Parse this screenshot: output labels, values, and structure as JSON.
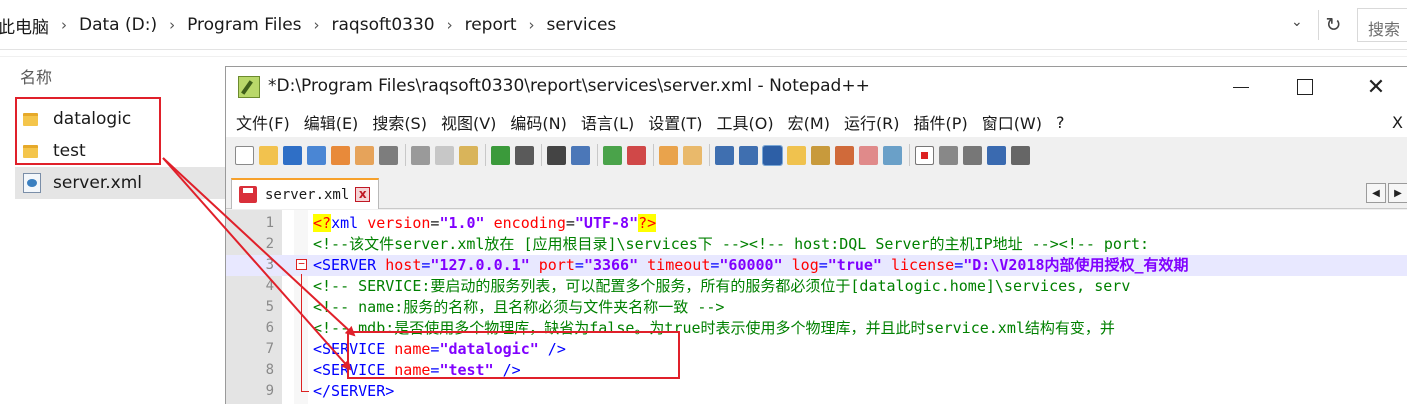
{
  "explorer": {
    "breadcrumb": [
      "此电脑",
      "Data (D:)",
      "Program Files",
      "raqsoft0330",
      "report",
      "services"
    ],
    "search_placeholder": "搜索",
    "column_header": "名称",
    "files": [
      {
        "name": "datalogic",
        "type": "folder",
        "icon": "folder-icon"
      },
      {
        "name": "test",
        "type": "folder",
        "icon": "folder-icon"
      },
      {
        "name": "server.xml",
        "type": "xml",
        "icon": "xml-file-icon",
        "selected": true
      }
    ]
  },
  "notepad": {
    "title": "*D:\\Program Files\\raqsoft0330\\report\\services\\server.xml - Notepad++",
    "menu": [
      "文件(F)",
      "编辑(E)",
      "搜索(S)",
      "视图(V)",
      "编码(N)",
      "语言(L)",
      "设置(T)",
      "工具(O)",
      "宏(M)",
      "运行(R)",
      "插件(P)",
      "窗口(W)",
      "?"
    ],
    "menu_close": "X",
    "tab": {
      "label": "server.xml",
      "close": "x"
    },
    "lines": [
      {
        "num": "1",
        "segments": [
          {
            "t": "<?",
            "c": "pi"
          },
          {
            "t": "xml ",
            "c": "tag"
          },
          {
            "t": "version",
            "c": "piattr"
          },
          {
            "t": "=",
            "c": "ptxt"
          },
          {
            "t": "\"1.0\"",
            "c": "str"
          },
          {
            "t": " ",
            "c": "ptxt"
          },
          {
            "t": "encoding",
            "c": "piattr"
          },
          {
            "t": "=",
            "c": "ptxt"
          },
          {
            "t": "\"UTF-8\"",
            "c": "str"
          },
          {
            "t": "?>",
            "c": "pi"
          }
        ]
      },
      {
        "num": "2",
        "segments": [
          {
            "t": "<!--该文件server.xml放在 [应用根目录]\\services下  --><!-- host:DQL Server的主机IP地址  --><!-- port:",
            "c": "cmt"
          }
        ]
      },
      {
        "num": "3",
        "current": true,
        "segments": [
          {
            "t": "<SERVER ",
            "c": "tag"
          },
          {
            "t": "host",
            "c": "attr"
          },
          {
            "t": "=",
            "c": "tag"
          },
          {
            "t": "\"127.0.0.1\"",
            "c": "str"
          },
          {
            "t": " ",
            "c": "tag"
          },
          {
            "t": "port",
            "c": "attr"
          },
          {
            "t": "=",
            "c": "tag"
          },
          {
            "t": "\"3366\"",
            "c": "str"
          },
          {
            "t": " ",
            "c": "tag"
          },
          {
            "t": "timeout",
            "c": "attr"
          },
          {
            "t": "=",
            "c": "tag"
          },
          {
            "t": "\"60000\"",
            "c": "str"
          },
          {
            "t": " ",
            "c": "tag"
          },
          {
            "t": "log",
            "c": "attr"
          },
          {
            "t": "=",
            "c": "tag"
          },
          {
            "t": "\"true\"",
            "c": "str"
          },
          {
            "t": " ",
            "c": "tag"
          },
          {
            "t": "license",
            "c": "attr"
          },
          {
            "t": "=",
            "c": "tag"
          },
          {
            "t": "\"D:\\V2018内部使用授权_有效期",
            "c": "str"
          }
        ]
      },
      {
        "num": "4",
        "segments": [
          {
            "t": "<!-- SERVICE:要启动的服务列表，可以配置多个服务，所有的服务都必须位于[datalogic.home]\\services, serv",
            "c": "cmt"
          }
        ]
      },
      {
        "num": "5",
        "segments": [
          {
            "t": "<!-- name:服务的名称，且名称必须与文件夹名称一致 -->",
            "c": "cmt"
          }
        ]
      },
      {
        "num": "6",
        "segments": [
          {
            "t": "<!-- mdb:是否使用多个物理库，缺省为false。为true时表示使用多个物理库，并且此时service.xml结构有变，并",
            "c": "cmt"
          }
        ]
      },
      {
        "num": "7",
        "segments": [
          {
            "t": "    <SERVICE ",
            "c": "tag"
          },
          {
            "t": "name",
            "c": "attr"
          },
          {
            "t": "=",
            "c": "tag"
          },
          {
            "t": "\"datalogic\"",
            "c": "str"
          },
          {
            "t": " />",
            "c": "tag"
          }
        ]
      },
      {
        "num": "8",
        "segments": [
          {
            "t": "    <SERVICE ",
            "c": "tag"
          },
          {
            "t": "name",
            "c": "attr"
          },
          {
            "t": "=",
            "c": "tag"
          },
          {
            "t": "\"test\"",
            "c": "str"
          },
          {
            "t": " />",
            "c": "tag"
          }
        ]
      },
      {
        "num": "9",
        "segments": [
          {
            "t": "</SERVER>",
            "c": "tag"
          }
        ]
      }
    ]
  },
  "colors": {
    "highlight_box": "#e0202a",
    "arrow": "#e0202a"
  }
}
